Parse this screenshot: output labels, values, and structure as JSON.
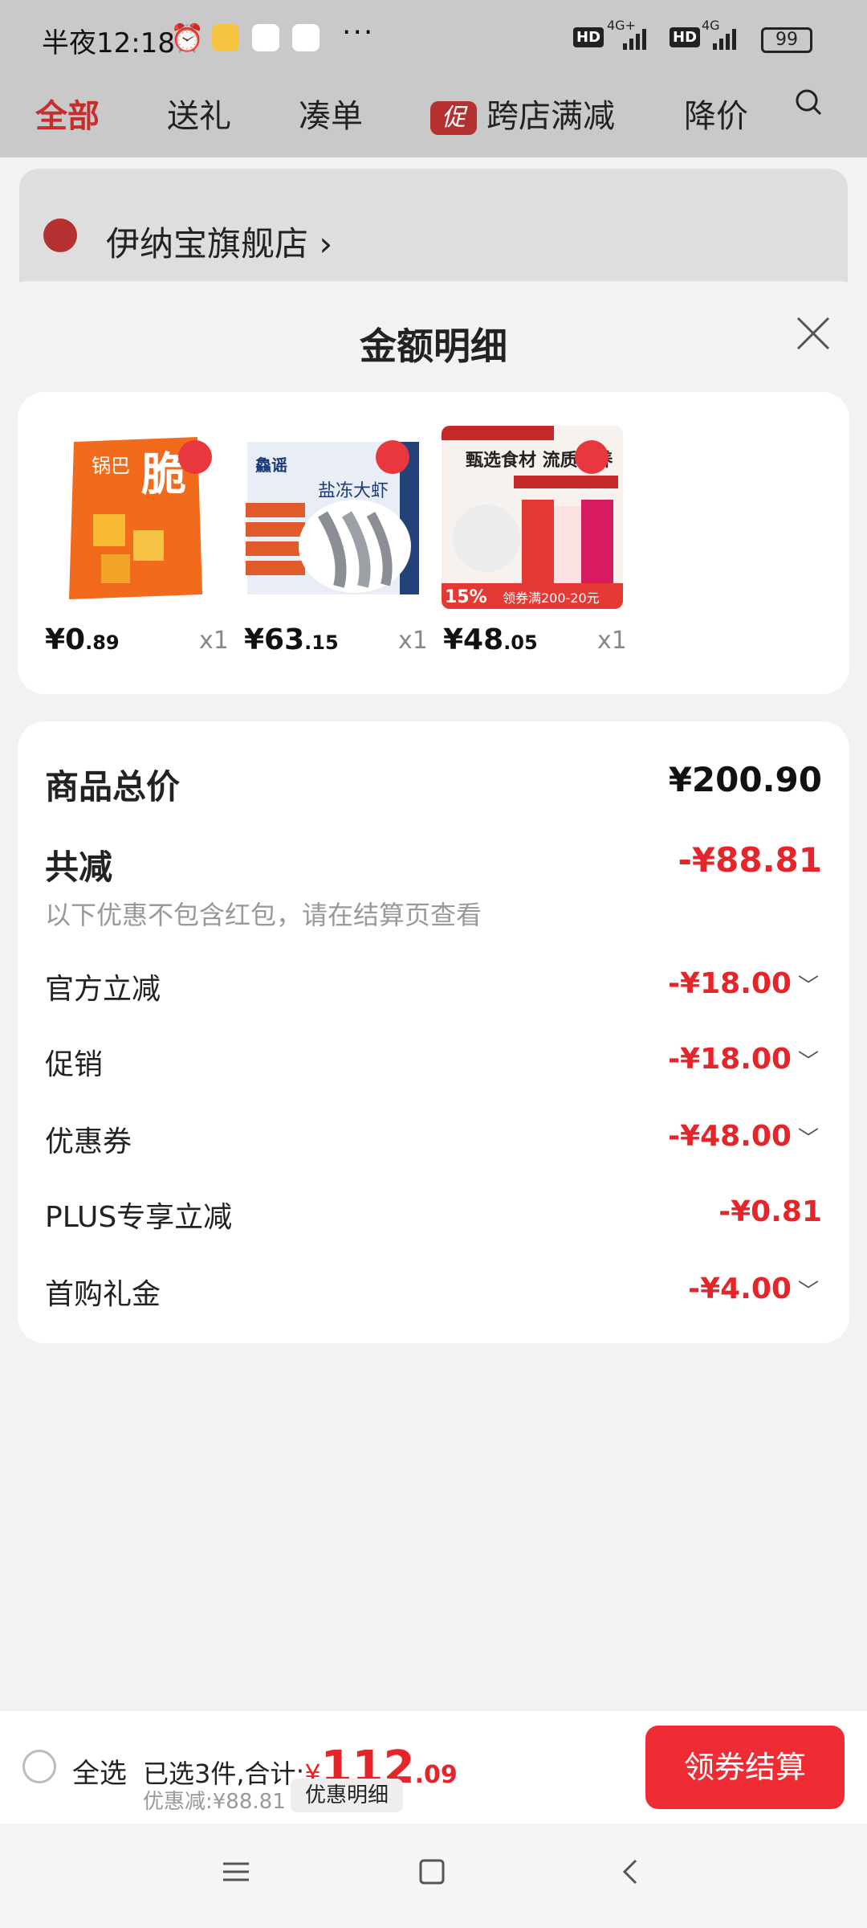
{
  "status_bar": {
    "time": "半夜12:18",
    "net1": "4G+",
    "net2": "4G",
    "hd": "HD",
    "battery": "99"
  },
  "tabs": [
    {
      "label": "全部",
      "active": true
    },
    {
      "label": "送礼"
    },
    {
      "label": "凑单"
    },
    {
      "label": "跨店满减",
      "badge": "促"
    },
    {
      "label": "降价"
    }
  ],
  "store": {
    "name": "伊纳宝旗舰店 ›"
  },
  "sheet": {
    "title": "金额明细",
    "products": [
      {
        "price_int": "¥0",
        "price_dec": ".89",
        "qty": "x1",
        "img": "crispy-snack-bag"
      },
      {
        "price_int": "¥63",
        "price_dec": ".15",
        "qty": "x1",
        "img": "frozen-shrimp-box"
      },
      {
        "price_int": "¥48",
        "price_dec": ".05",
        "qty": "x1",
        "img": "cat-treat-pack"
      }
    ],
    "total_label": "商品总价",
    "total_value": "¥200.90",
    "reduce_label": "共减",
    "reduce_value": "-¥88.81",
    "note": "以下优惠不包含红包，请在结算页查看",
    "discounts": [
      {
        "label": "官方立减",
        "value": "-¥18.00",
        "expandable": true
      },
      {
        "label": "促销",
        "value": "-¥18.00",
        "expandable": true
      },
      {
        "label": "优惠券",
        "value": "-¥48.00",
        "expandable": true
      },
      {
        "label": "PLUS专享立减",
        "value": "-¥0.81",
        "expandable": false
      },
      {
        "label": "首购礼金",
        "value": "-¥4.00",
        "expandable": true
      }
    ]
  },
  "bottom_bar": {
    "select_all": "全选",
    "summary_prefix": "已选3件,合计:",
    "currency": "¥",
    "total_int": "112",
    "total_dec": ".09",
    "discount_line": "优惠减:¥88.81",
    "detail_button": "优惠明细",
    "checkout_button": "领券结算"
  },
  "colors": {
    "accent": "#e4262a",
    "checkout": "#ef2c34",
    "tab_active": "#c82d2d"
  }
}
